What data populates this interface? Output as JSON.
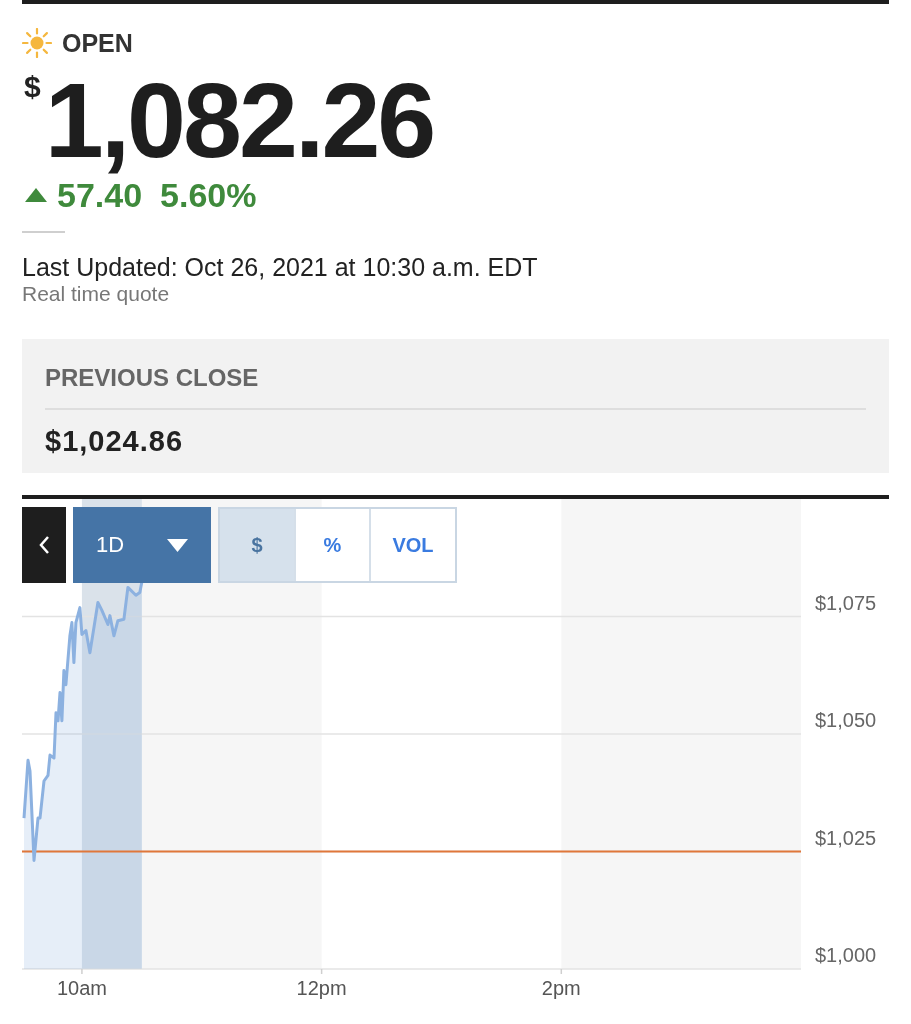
{
  "status": {
    "label": "OPEN"
  },
  "quote": {
    "currency": "$",
    "price": "1,082.26",
    "rising": true,
    "change": "57.40",
    "change_percent": "5.60%"
  },
  "updated": {
    "text": "Last Updated: Oct 26, 2021 at 10:30 a.m. EDT",
    "note": "Real time quote"
  },
  "previous_close": {
    "label": "PREVIOUS CLOSE",
    "value": "$1,024.86"
  },
  "chart": {
    "range": "1D",
    "modes": [
      {
        "label": "$",
        "selected": true
      },
      {
        "label": "%",
        "selected": false
      },
      {
        "label": "VOL",
        "selected": false
      }
    ],
    "chart_data": {
      "type": "area",
      "x": [
        "2021-10-26T09:31",
        "2021-10-26T09:33",
        "2021-10-26T09:34",
        "2021-10-26T09:36",
        "2021-10-26T09:38",
        "2021-10-26T09:39",
        "2021-10-26T09:41",
        "2021-10-26T09:43",
        "2021-10-26T09:44",
        "2021-10-26T09:46",
        "2021-10-26T09:47",
        "2021-10-26T09:48",
        "2021-10-26T09:49",
        "2021-10-26T09:50",
        "2021-10-26T09:51",
        "2021-10-26T09:52",
        "2021-10-26T09:54",
        "2021-10-26T09:55",
        "2021-10-26T09:56",
        "2021-10-26T09:57",
        "2021-10-26T09:59",
        "2021-10-26T10:00",
        "2021-10-26T10:02",
        "2021-10-26T10:04",
        "2021-10-26T10:06",
        "2021-10-26T10:08",
        "2021-10-26T10:10",
        "2021-10-26T10:13",
        "2021-10-26T10:14",
        "2021-10-26T10:16",
        "2021-10-26T10:18",
        "2021-10-26T10:21",
        "2021-10-26T10:23",
        "2021-10-26T10:27",
        "2021-10-26T10:29",
        "2021-10-26T10:30"
      ],
      "series": [
        {
          "color": "#8cb1e0",
          "values": [
            1032.1,
            1044.4,
            1042.1,
            1023.1,
            1032.1,
            1032.1,
            1040,
            1041.2,
            1045.5,
            1044.9,
            1054.5,
            1052.8,
            1058.8,
            1052.8,
            1063.5,
            1060.5,
            1070.9,
            1073.7,
            1065.2,
            1073.7,
            1076.9,
            1071.2,
            1072,
            1067.3,
            1072.6,
            1078,
            1076.3,
            1073.3,
            1075.2,
            1070.9,
            1074.1,
            1074.4,
            1081.2,
            1079.5,
            1080.1,
            1082.3
          ]
        }
      ],
      "xlim": [
        "2021-10-26T09:30",
        "2021-10-26T16:00"
      ],
      "ylim": [
        1000,
        1100
      ],
      "xticks": [
        {
          "value": "2021-10-26T10:00",
          "label": "10am"
        },
        {
          "value": "2021-10-26T12:00",
          "label": "12pm"
        },
        {
          "value": "2021-10-26T14:00",
          "label": "2pm"
        }
      ],
      "yticks": [
        {
          "value": 1000,
          "label": "$1,000"
        },
        {
          "value": 1025,
          "label": "$1,025"
        },
        {
          "value": 1050,
          "label": "$1,050"
        },
        {
          "value": 1075,
          "label": "$1,075"
        }
      ],
      "grid": true,
      "bands": [
        {
          "axis": "x",
          "from": "2021-10-26T10:00",
          "to": "2021-10-26T12:00",
          "color": "#f6f6f6"
        },
        {
          "axis": "x",
          "from": "2021-10-26T14:00",
          "to": "2021-10-26T16:00",
          "color": "#f6f6f6"
        },
        {
          "axis": "x",
          "from": "2021-10-26T10:00",
          "to": "2021-10-26T10:30",
          "color": "#dae2ea"
        }
      ],
      "ref_lines": [
        {
          "axis": "y",
          "value": 1025,
          "color": "#e0773a"
        }
      ]
    }
  }
}
